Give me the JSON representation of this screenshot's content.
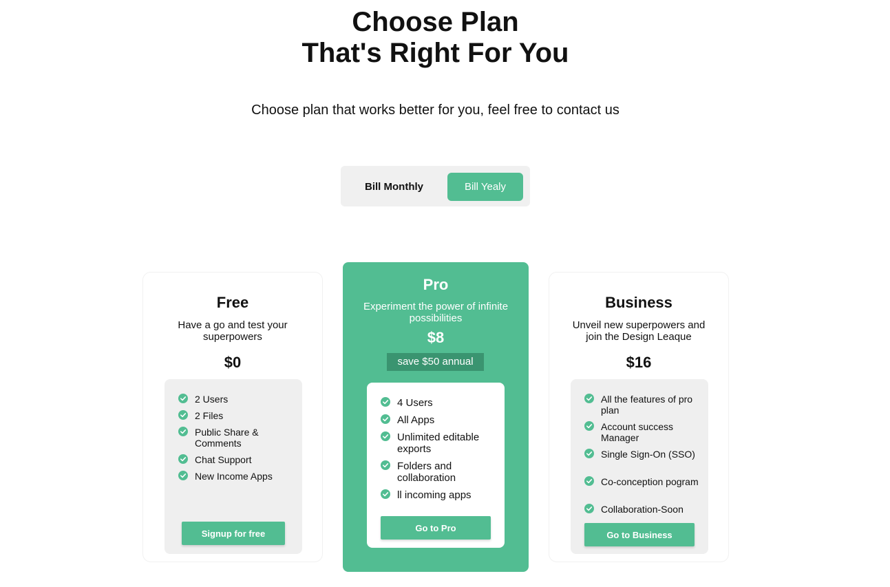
{
  "header": {
    "title_line1": "Choose Plan",
    "title_line2": "That's Right For You",
    "subtitle": "Choose plan that works better for you, feel free to contact us"
  },
  "billing_toggle": {
    "monthly_label": "Bill Monthly",
    "yearly_label": "Bill Yealy",
    "selected": "yearly"
  },
  "colors": {
    "accent": "#52bd92",
    "accent_dark": "#3a9470",
    "panel": "#efefef"
  },
  "plans": [
    {
      "name": "Free",
      "description": "Have a go and test your superpowers",
      "price": "$0",
      "features": [
        "2 Users",
        "2 Files",
        "Public Share & Comments",
        "Chat Support",
        "New Income Apps"
      ],
      "cta": "Signup for free"
    },
    {
      "name": "Pro",
      "description": "Experiment the power of infinite possibilities",
      "price": "$8",
      "badge": "save $50 annual",
      "features": [
        "4 Users",
        "All Apps",
        "Unlimited editable exports",
        "Folders and collaboration",
        "ll incoming apps"
      ],
      "cta": "Go to Pro"
    },
    {
      "name": "Business",
      "description": "Unveil new superpowers and join the Design Leaque",
      "price": "$16",
      "features": [
        "All the features of pro plan",
        "Account success Manager",
        "Single Sign-On (SSO)",
        "Co-conception pogram",
        "Collaboration-Soon"
      ],
      "cta": "Go to Business"
    }
  ]
}
